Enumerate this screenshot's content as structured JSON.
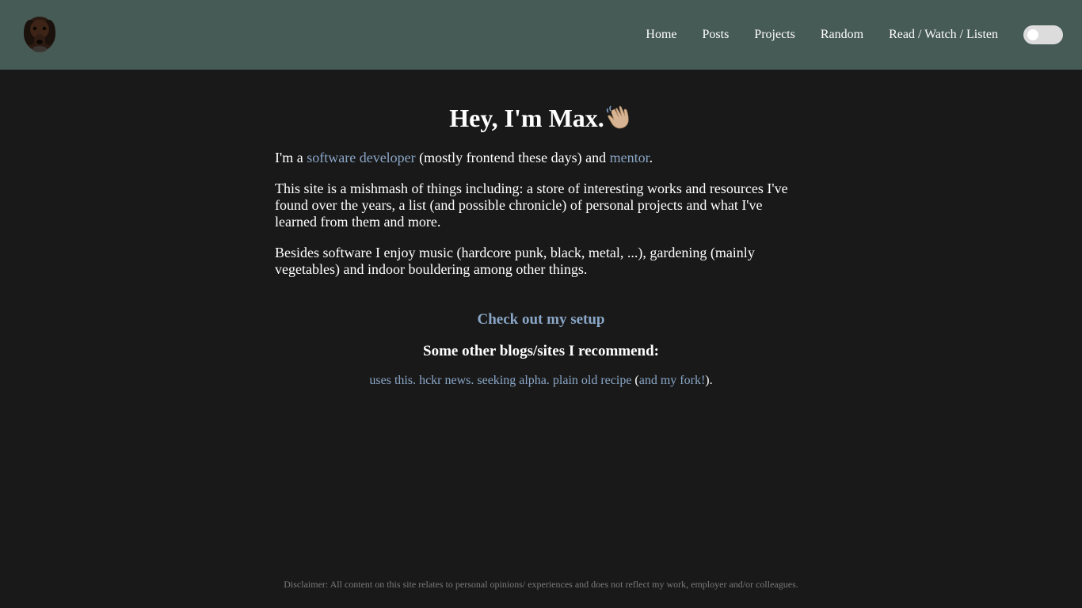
{
  "header": {
    "logo_icon": "dog-avatar-icon",
    "nav": [
      {
        "label": "Home"
      },
      {
        "label": "Posts"
      },
      {
        "label": "Projects"
      },
      {
        "label": "Random"
      },
      {
        "label": "Read / Watch / Listen"
      }
    ],
    "theme_toggle_icon": "theme-toggle-icon"
  },
  "hero": {
    "title": "Hey, I'm Max.",
    "wave_icon": "waving-hand-icon"
  },
  "intro": {
    "p1_prefix": "I'm a ",
    "p1_link1": "software developer",
    "p1_middle": " (mostly frontend these days) and ",
    "p1_link2": "mentor",
    "p1_suffix": ".",
    "p2": "This site is a mishmash of things including: a store of interesting works and resources I've found over the years, a list (and possible chronicle) of personal projects and what I've learned from them and more.",
    "p3": "Besides software I enjoy music (hardcore punk, black, metal, ...), gardening (mainly vegetables) and indoor bouldering among other things."
  },
  "setup_link": "Check out my setup",
  "recommend": {
    "heading": "Some other blogs/sites I recommend:",
    "sites": [
      "uses this.",
      "hckr news.",
      "seeking alpha.",
      "plain old recipe"
    ],
    "fork_open": "(",
    "fork_link": "and my fork!",
    "fork_close": ")."
  },
  "footer": {
    "disclaimer": "Disclaimer: All content on this site relates to personal opinions/ experiences and does not reflect my work, employer and/or colleagues."
  },
  "colors": {
    "header_bg": "#465a56",
    "page_bg": "#191919",
    "link": "#8aa6c6",
    "toggle_track": "#dcdcdc"
  }
}
